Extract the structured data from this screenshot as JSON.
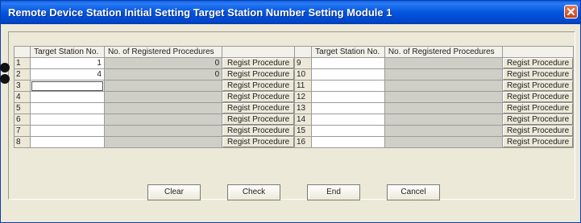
{
  "window": {
    "title": "Remote Device Station Initial Setting Target Station Number Setting Module 1"
  },
  "table": {
    "headers": {
      "target_station": "Target Station No.",
      "registered": "No. of Registered Procedures"
    },
    "rows": [
      {
        "left_no": "1",
        "left_target": "1",
        "left_count": "0",
        "left_button": "Regist Procedure",
        "right_no": "9",
        "right_target": "",
        "right_count": "",
        "right_button": "Regist Procedure"
      },
      {
        "left_no": "2",
        "left_target": "4",
        "left_count": "0",
        "left_button": "Regist Procedure",
        "right_no": "10",
        "right_target": "",
        "right_count": "",
        "right_button": "Regist Procedure"
      },
      {
        "left_no": "3",
        "left_target": "",
        "left_count": "",
        "left_button": "Regist Procedure",
        "right_no": "11",
        "right_target": "",
        "right_count": "",
        "right_button": "Regist Procedure"
      },
      {
        "left_no": "4",
        "left_target": "",
        "left_count": "",
        "left_button": "Regist Procedure",
        "right_no": "12",
        "right_target": "",
        "right_count": "",
        "right_button": "Regist Procedure"
      },
      {
        "left_no": "5",
        "left_target": "",
        "left_count": "",
        "left_button": "Regist Procedure",
        "right_no": "13",
        "right_target": "",
        "right_count": "",
        "right_button": "Regist Procedure"
      },
      {
        "left_no": "6",
        "left_target": "",
        "left_count": "",
        "left_button": "Regist Procedure",
        "right_no": "14",
        "right_target": "",
        "right_count": "",
        "right_button": "Regist Procedure"
      },
      {
        "left_no": "7",
        "left_target": "",
        "left_count": "",
        "left_button": "Regist Procedure",
        "right_no": "15",
        "right_target": "",
        "right_count": "",
        "right_button": "Regist Procedure"
      },
      {
        "left_no": "8",
        "left_target": "",
        "left_count": "",
        "left_button": "Regist Procedure",
        "right_no": "16",
        "right_target": "",
        "right_count": "",
        "right_button": "Regist Procedure"
      }
    ]
  },
  "buttons": {
    "clear": "Clear",
    "check": "Check",
    "end": "End",
    "cancel": "Cancel"
  },
  "colors": {
    "titlebar": "#0355e0",
    "window_bg": "#ece9d8",
    "readonly_cell": "#cfcfc8",
    "close_button": "#c8411e"
  },
  "icons": {
    "close": "close-icon",
    "callouts": "callout-dot"
  }
}
